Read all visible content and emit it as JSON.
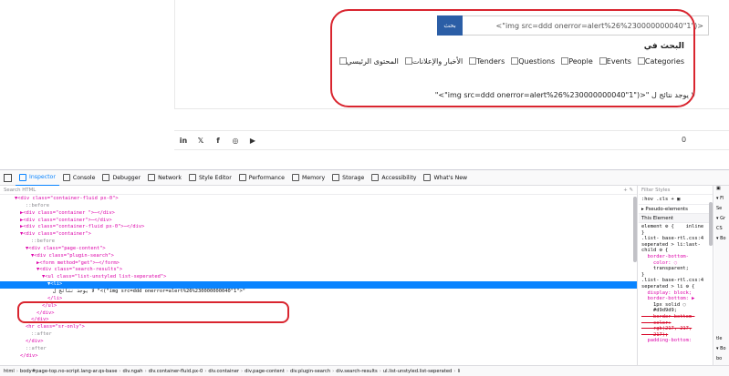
{
  "page": {
    "search_button_label": "بحث",
    "search_input_value": "<(\"img src=ddd onerror=alert%26%230000000040\"1\">",
    "search_in_title": "البحث في",
    "categories": [
      {
        "label": "Categories",
        "checked": false
      },
      {
        "label": "Events",
        "checked": false
      },
      {
        "label": "People",
        "checked": false
      },
      {
        "label": "Questions",
        "checked": false
      },
      {
        "label": "Tenders",
        "checked": false
      },
      {
        "label": "الأخبار والإعلانات",
        "checked": false
      },
      {
        "label": "المحتوى الرئيسي",
        "checked": false
      }
    ],
    "no_results_text": "لا يوجد نتائج ل \"<(\"img src=ddd onerror=alert%26%230000000040\"1\">\"",
    "social_icons": [
      {
        "label": "in",
        "icon": "linkedin-icon"
      },
      {
        "label": "𝕏",
        "icon": "twitter-icon"
      },
      {
        "label": "f",
        "icon": "facebook-icon"
      },
      {
        "label": "◎",
        "icon": "instagram-icon"
      },
      {
        "label": "▶",
        "icon": "youtube-icon"
      }
    ],
    "footer_glyph": "0",
    "annotation_color": "#d9252f"
  },
  "devtools": {
    "tabs": [
      {
        "label": "Inspector",
        "active": true
      },
      {
        "label": "Console",
        "active": false
      },
      {
        "label": "Debugger",
        "active": false
      },
      {
        "label": "Network",
        "active": false
      },
      {
        "label": "Style Editor",
        "active": false
      },
      {
        "label": "Performance",
        "active": false
      },
      {
        "label": "Memory",
        "active": false
      },
      {
        "label": "Storage",
        "active": false
      },
      {
        "label": "Accessibility",
        "active": false
      },
      {
        "label": "What's New",
        "active": false
      }
    ],
    "search_placeholder": "Search HTML",
    "markup_lines": [
      {
        "indent": 2,
        "text": "▼<div class=\"container-fluid px-0\">",
        "selected": false
      },
      {
        "indent": 4,
        "text": "::before",
        "selected": false
      },
      {
        "indent": 3,
        "text": "▶<div class=\"container \">⋯</div>",
        "selected": false
      },
      {
        "indent": 3,
        "text": "▶<div class=\"container\">⋯</div>",
        "selected": false
      },
      {
        "indent": 3,
        "text": "▶<div class=\"container-fluid px-0\">⋯</div>",
        "selected": false
      },
      {
        "indent": 3,
        "text": "▼<div class=\"container\">",
        "selected": false
      },
      {
        "indent": 5,
        "text": "::before",
        "selected": false
      },
      {
        "indent": 4,
        "text": "▼<div class=\"page-content\">",
        "selected": false
      },
      {
        "indent": 5,
        "text": "▼<div class=\"plugin-search\">",
        "selected": false
      },
      {
        "indent": 6,
        "text": "▶<form method=\"get\">⋯</form>",
        "selected": false
      },
      {
        "indent": 6,
        "text": "▼<div class=\"search-results\">",
        "selected": false
      },
      {
        "indent": 7,
        "text": "▼<ul class=\"list-unstyled list-seperated\">",
        "selected": false
      },
      {
        "indent": 8,
        "text": "▼<li>",
        "selected": true
      },
      {
        "indent": 9,
        "text": "لا يوجد نتائج ل \"<(\"img src=ddd onerror=alert%26%230000000040\"1\">\"",
        "selected": false
      },
      {
        "indent": 8,
        "text": "</li>",
        "selected": false
      },
      {
        "indent": 7,
        "text": "</ul>",
        "selected": false
      },
      {
        "indent": 6,
        "text": "</div>",
        "selected": false
      },
      {
        "indent": 5,
        "text": "</div>",
        "selected": false
      },
      {
        "indent": 4,
        "text": "<hr class=\"sr-only\">",
        "selected": false
      },
      {
        "indent": 5,
        "text": "::after",
        "selected": false
      },
      {
        "indent": 4,
        "text": "</div>",
        "selected": false
      },
      {
        "indent": 4,
        "text": "::after",
        "selected": false
      },
      {
        "indent": 3,
        "text": "</div>",
        "selected": false
      }
    ],
    "rules": {
      "filter_placeholder": "Filter Styles",
      "tools": ":hov  .cls  +  ▣",
      "pseudo_label": "Pseudo-elements",
      "this_element": "This Element",
      "code_lines": [
        "element ⚙ {    inline",
        "}",
        ".list- base-rtl.css:4",
        "seperated > li:last-",
        "child ⚙ {",
        "  border-bottom-",
        "    color: ◌",
        "    transparent;",
        "}",
        ".list- base-rtl.css:4",
        "seperated > li ⚙ {",
        "  display: block;",
        "  border-bottom: ▶",
        "    1px solid ◌",
        "    #d9d9d9;",
        "    border-bottom-",
        "    color:",
        "    rgb(217, 217,",
        "    217);",
        "  padding-bottom:"
      ]
    },
    "side_panel": [
      "▣",
      "▾ Fl",
      "Se",
      "▾ Gr",
      "CS",
      "▾ Bo",
      "",
      "",
      "",
      "",
      "",
      "",
      "",
      "",
      "",
      "tle",
      "▾ Bo",
      "bo",
      "di",
      "bo"
    ],
    "breadcrumb": [
      "html",
      "body#page-top.no-script.lang-ar.qs-base",
      "div.ngah",
      "div.container-fluid.px-0",
      "div.container",
      "div.page-content",
      "div.plugin-search",
      "div.search-results",
      "ul.list-unstyled.list-seperated",
      "li"
    ]
  }
}
